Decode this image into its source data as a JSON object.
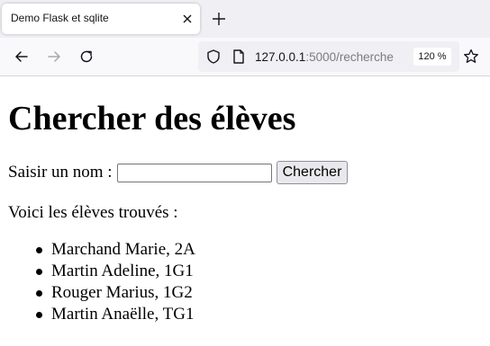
{
  "browser": {
    "tab_title": "Demo Flask et sqlite",
    "url_host": "127.0.0.1",
    "url_rest": ":5000/recherche",
    "zoom": "120 %",
    "icons": {
      "tab_close": "close-icon",
      "new_tab": "plus-icon",
      "back": "back-arrow-icon",
      "forward": "forward-arrow-icon",
      "reload": "reload-icon",
      "tracking": "shield-icon",
      "page_info": "page-icon",
      "bookmark": "star-icon"
    }
  },
  "page": {
    "title": "Chercher des élèves",
    "search": {
      "label": "Saisir un nom :",
      "value": "",
      "placeholder": "",
      "button_label": "Chercher"
    },
    "results_intro": "Voici les élèves trouvés :",
    "students": [
      "Marchand Marie, 2A",
      "Martin Adeline, 1G1",
      "Rouger Marius, 1G2",
      "Martin Anaëlle, TG1"
    ]
  }
}
